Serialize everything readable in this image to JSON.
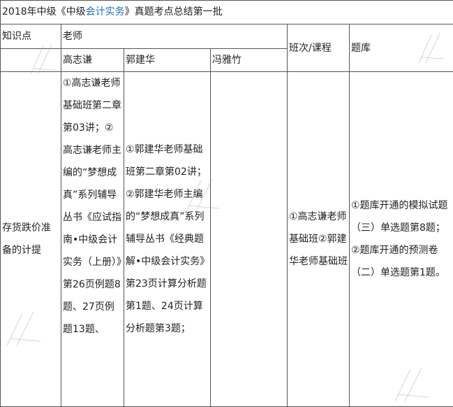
{
  "title": {
    "prefix": "2018年中级《中级",
    "highlight": "会计实务",
    "suffix": "》真题考点总结第一批"
  },
  "headers": {
    "knowledge_point": "知识点",
    "teacher": "老师",
    "class_course": "班次/课程",
    "question_bank": "题库",
    "teachers": [
      "高志谦",
      "郭建华",
      "冯雅竹"
    ]
  },
  "row": {
    "knowledge_point": "存货跌价准备的计提",
    "gao": "①高志谦老师基础班第二章第03讲；②高志谦老师主编的“梦想成真”系列辅导丛书《应试指南•中级会计实务（上册）》第26页例题8题、27页例题13题、",
    "guo": "①郭建华老师基础班第二章第02讲；②郭建华老师主编的“梦想成真”系列辅导丛书《经典题解•中级会计实务》第23页计算分析题第1题、24页计算分析题第3题；",
    "feng": "",
    "class_course": "①高志谦老师基础班②郭建华老师基础班",
    "question_bank": "①题库开通的模拟试题（三）单选题第8题；②题库开通的预测卷（二）单选题第1题。"
  }
}
